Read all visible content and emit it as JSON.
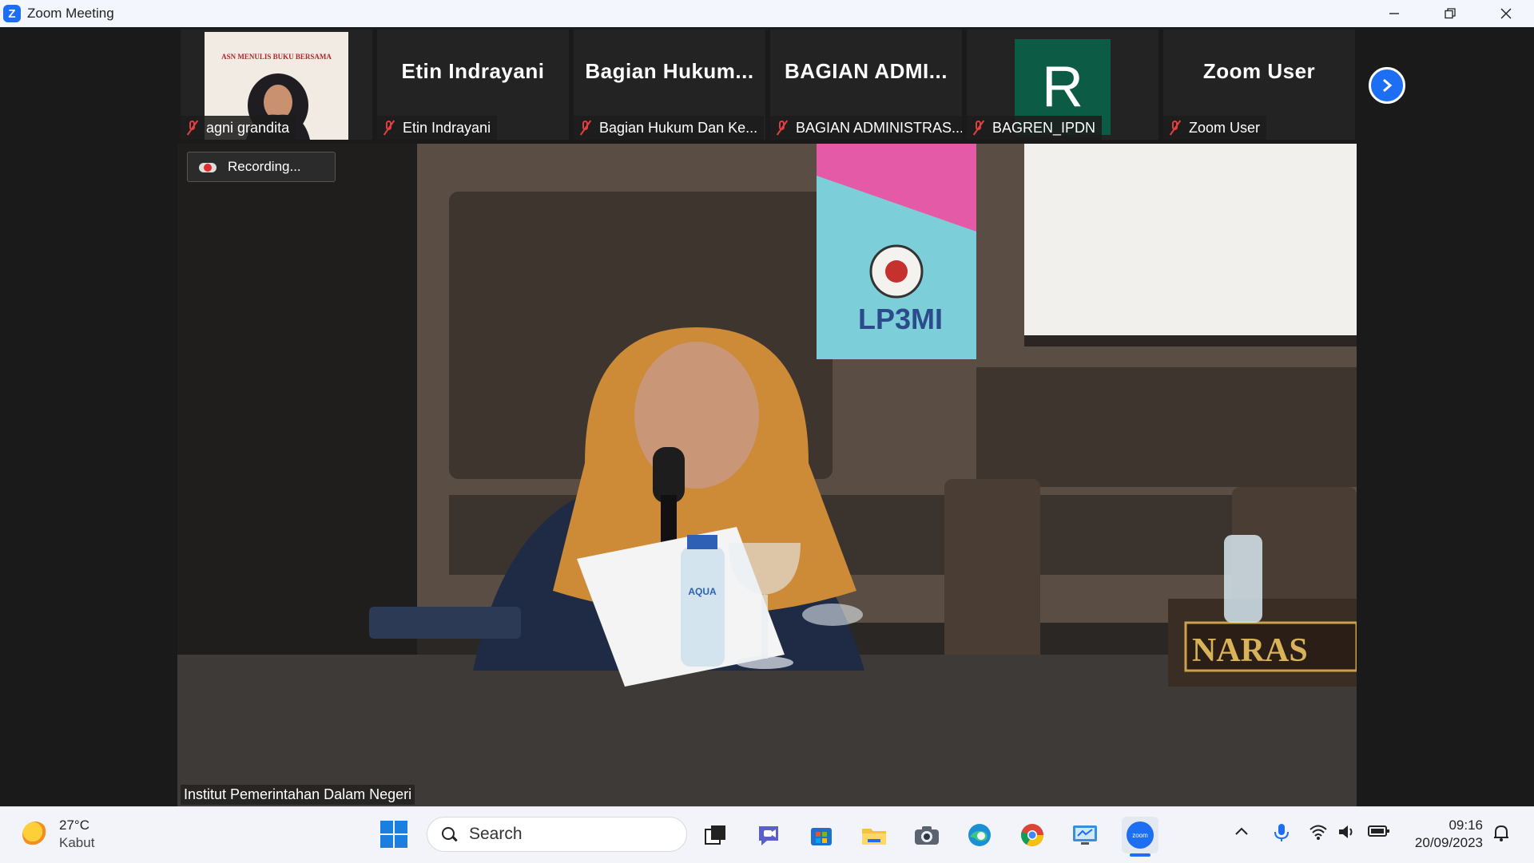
{
  "window": {
    "title": "Zoom Meeting",
    "logo": "Z",
    "controls": [
      "minimize-icon",
      "restore-icon",
      "close-icon"
    ]
  },
  "participants": [
    {
      "display_name": "",
      "label": "agni grandita",
      "has_video": true,
      "banner_text": "ASN MENULIS BUKU BERSAMA"
    },
    {
      "display_name": "Etin Indrayani",
      "label": "Etin Indrayani",
      "has_video": false
    },
    {
      "display_name": "Bagian  Hukum...",
      "label": "Bagian Hukum Dan Ke...",
      "has_video": false
    },
    {
      "display_name": "BAGIAN  ADMI...",
      "label": "BAGIAN ADMINISTRAS...",
      "has_video": false
    },
    {
      "display_name": "R",
      "label": "BAGREN_IPDN",
      "has_video": false,
      "avatar_color": "#0b5b45"
    },
    {
      "display_name": "Zoom User",
      "label": "Zoom User",
      "has_video": false
    }
  ],
  "main": {
    "recording_label": "Recording...",
    "speaker_name": "Institut Pemerintahan Dalam Negeri",
    "banner_logo_text": "LP3MI",
    "nameplate_text": "NARAS",
    "bottle_label": "AQUA"
  },
  "taskbar": {
    "weather_temp": "27°C",
    "weather_cond": "Kabut",
    "search_label": "Search",
    "time": "09:16",
    "date": "20/09/2023",
    "zoom_icon_label": "zoom"
  },
  "colors": {
    "accent": "#1c6ef2",
    "mute": "#e04040",
    "recording": "#e02b2b"
  }
}
